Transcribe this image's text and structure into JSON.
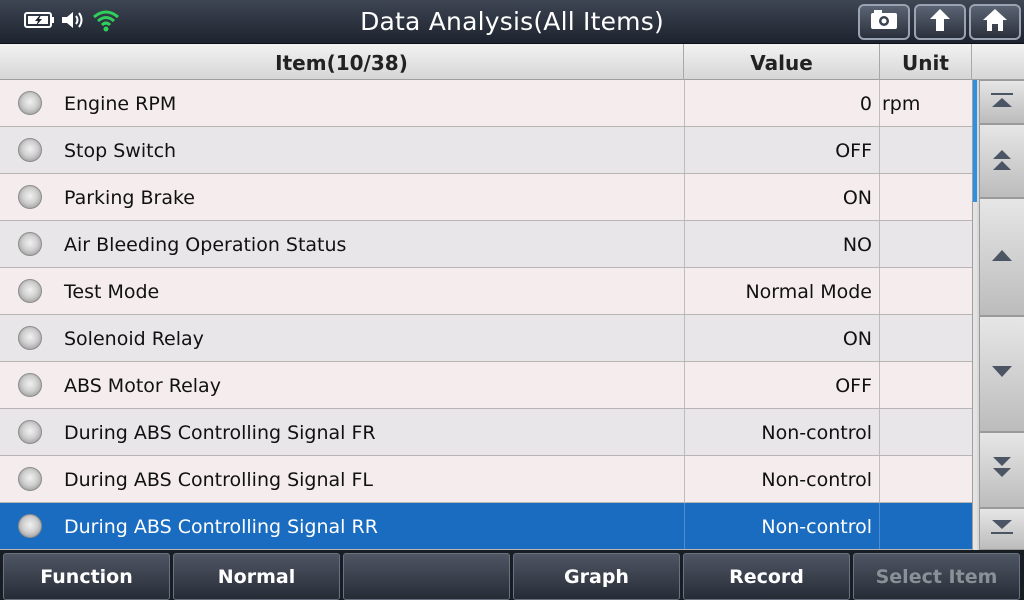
{
  "header": {
    "title": "Data Analysis(All Items)",
    "buttons": [
      "camera-icon",
      "upload-icon",
      "home-icon"
    ],
    "status_icons": [
      "battery-charging-icon",
      "speaker-icon",
      "wifi-icon"
    ]
  },
  "table": {
    "headers": {
      "item": "Item(10/38)",
      "value": "Value",
      "unit": "Unit"
    },
    "rows": [
      {
        "name": "Engine RPM",
        "value": "0",
        "unit": "rpm"
      },
      {
        "name": "Stop Switch",
        "value": "OFF",
        "unit": ""
      },
      {
        "name": "Parking Brake",
        "value": "ON",
        "unit": ""
      },
      {
        "name": "Air Bleeding Operation Status",
        "value": "NO",
        "unit": ""
      },
      {
        "name": "Test Mode",
        "value": "Normal Mode",
        "unit": ""
      },
      {
        "name": "Solenoid Relay",
        "value": "ON",
        "unit": ""
      },
      {
        "name": "ABS Motor Relay",
        "value": "OFF",
        "unit": ""
      },
      {
        "name": "During ABS Controlling Signal FR",
        "value": "Non-control",
        "unit": ""
      },
      {
        "name": "During ABS Controlling Signal FL",
        "value": "Non-control",
        "unit": ""
      },
      {
        "name": "During ABS Controlling Signal RR",
        "value": "Non-control",
        "unit": ""
      }
    ],
    "selected_index": 9
  },
  "scrollbar": {
    "buttons": [
      "scroll-top-icon",
      "page-up-icon",
      "line-up-icon",
      "line-down-icon",
      "page-down-icon",
      "scroll-bottom-icon"
    ]
  },
  "footer": {
    "buttons": [
      {
        "label": "Function",
        "enabled": true
      },
      {
        "label": "Normal",
        "enabled": true
      },
      {
        "label": "",
        "enabled": true
      },
      {
        "label": "Graph",
        "enabled": true
      },
      {
        "label": "Record",
        "enabled": true
      },
      {
        "label": "Select Item",
        "enabled": false
      }
    ]
  },
  "colors": {
    "accent": "#1a6cc0",
    "wifi": "#2fd05a",
    "header": "#2b313c"
  }
}
